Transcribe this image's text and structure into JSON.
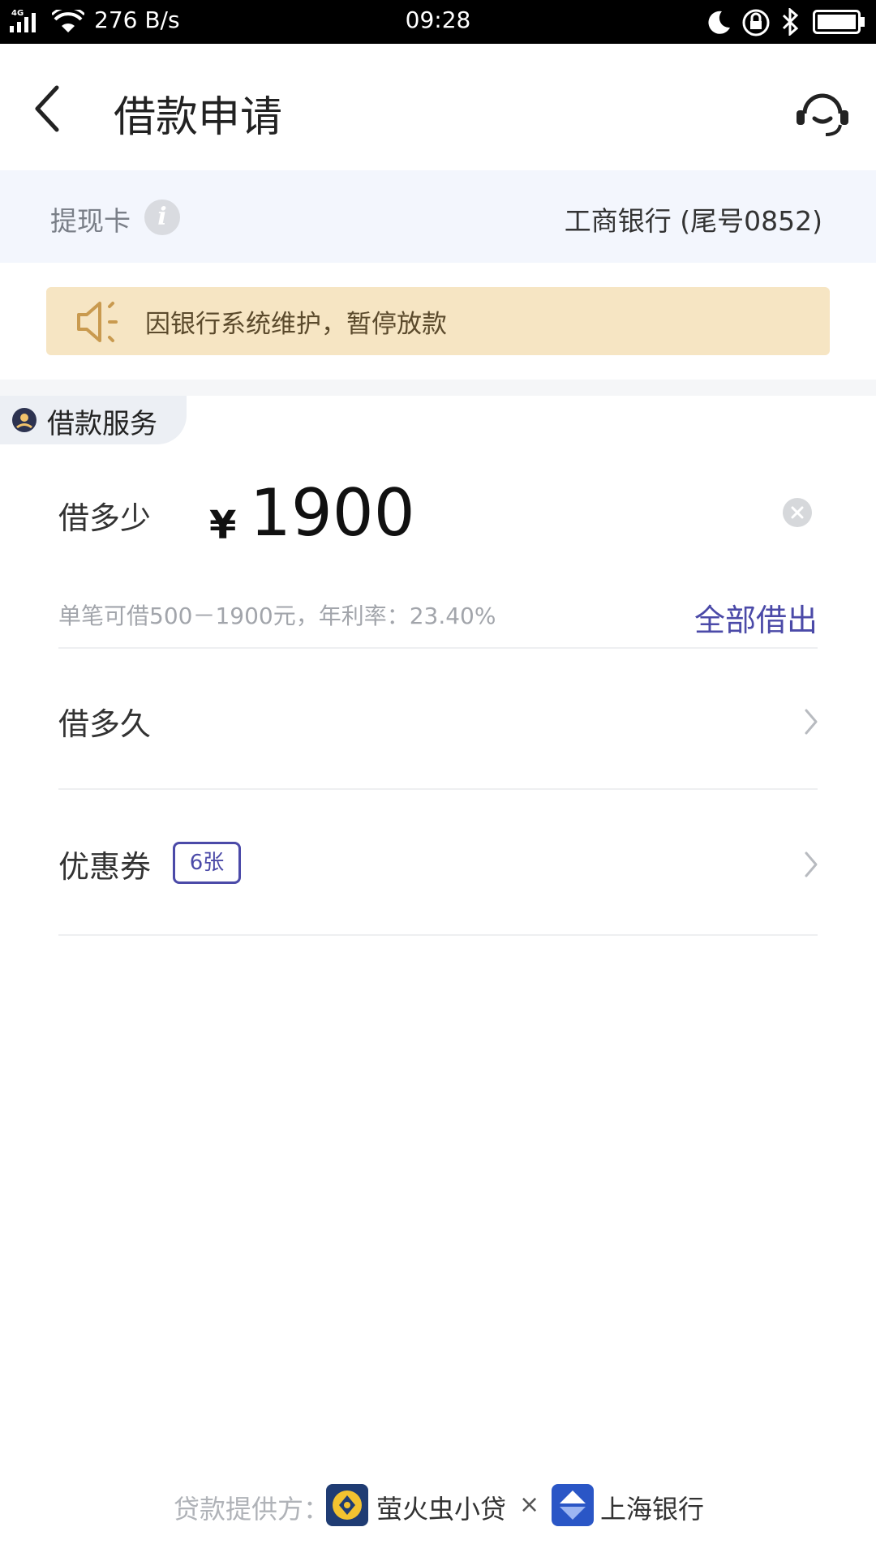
{
  "status_bar": {
    "network": "4G",
    "speed": "276 B/s",
    "time": "09:28",
    "icons": [
      "signal-icon",
      "wifi-icon",
      "moon-icon",
      "rotation-lock-icon",
      "bluetooth-icon",
      "battery-icon"
    ]
  },
  "header": {
    "title": "借款申请",
    "back_icon": "back-arrow-icon",
    "service_icon": "customer-service-icon"
  },
  "withdraw_card": {
    "label": "提现卡",
    "value": "工商银行 (尾号0852)"
  },
  "notice": {
    "text": "因银行系统维护，暂停放款",
    "icon": "speaker-icon"
  },
  "service_tag": {
    "label": "借款服务"
  },
  "amount": {
    "label": "借多少",
    "currency": "¥",
    "value": "1900",
    "hint": "单笔可借500－1900元，年利率：23.40%",
    "borrow_all": "全部借出"
  },
  "term": {
    "label": "借多久"
  },
  "coupon": {
    "label": "优惠券",
    "badge": "6张"
  },
  "footer": {
    "provider_label": "贷款提供方：",
    "provider_1": "萤火虫小贷",
    "separator": "×",
    "provider_2": "上海银行"
  },
  "colors": {
    "accent": "#4b4aa8",
    "notice_bg": "#f6e5c3",
    "card_row_bg": "#f3f6fd"
  }
}
